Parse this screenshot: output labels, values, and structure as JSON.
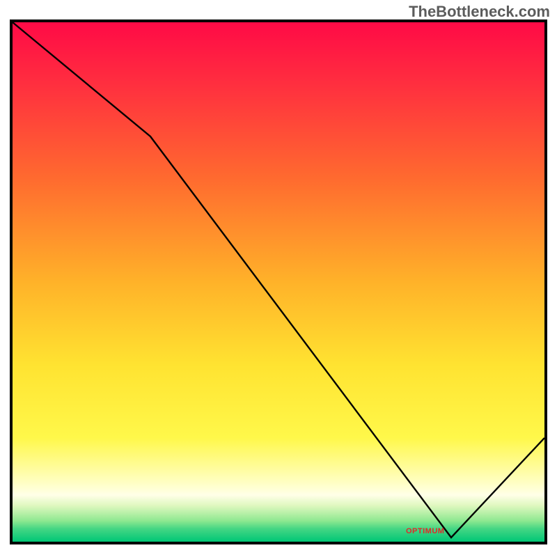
{
  "watermark": "TheBottleneck.com",
  "min_label": "OPTIMUM",
  "chart_data": {
    "type": "line",
    "title": "",
    "xlabel": "",
    "ylabel": "",
    "xlim": [
      0,
      100
    ],
    "ylim": [
      0,
      100
    ],
    "series": [
      {
        "name": "bottleneck-curve",
        "x": [
          0,
          26,
          82.5,
          100
        ],
        "values": [
          100,
          78,
          0.8,
          20
        ]
      }
    ],
    "minimum_x": 82.5,
    "gradient_stops": [
      {
        "pos": 0,
        "color": "#ff0a46"
      },
      {
        "pos": 0.5,
        "color": "#ffb229"
      },
      {
        "pos": 0.8,
        "color": "#fff84a"
      },
      {
        "pos": 0.93,
        "color": "#ffffe0"
      },
      {
        "pos": 1.0,
        "color": "#00c776"
      }
    ]
  }
}
